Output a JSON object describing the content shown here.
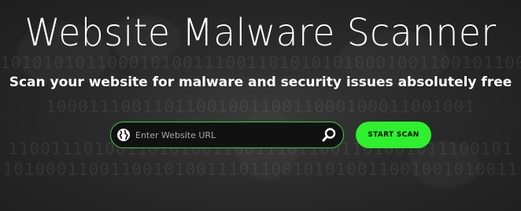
{
  "hero": {
    "title": "Website Malware Scanner",
    "subtitle": "Scan your website for malware and security issues absolutely free"
  },
  "search": {
    "placeholder": "Enter Website URL",
    "globe_icon": "globe-icon",
    "search_icon": "magnifier-icon"
  },
  "scan_button": {
    "label": "START SCAN"
  },
  "colors": {
    "accent": "#2ef02e",
    "border": "#3ccf3c",
    "background": "#262626",
    "text": "#ffffff"
  },
  "background_pattern": {
    "line1": "1010101011000101001110011010101010001001100101100010001",
    "line2": "1000111001101100100110011000100011001001",
    "line3": "11001110100110101001100111011001101001011100101",
    "line4": "101000110011001010011101100101010011001001010011"
  }
}
